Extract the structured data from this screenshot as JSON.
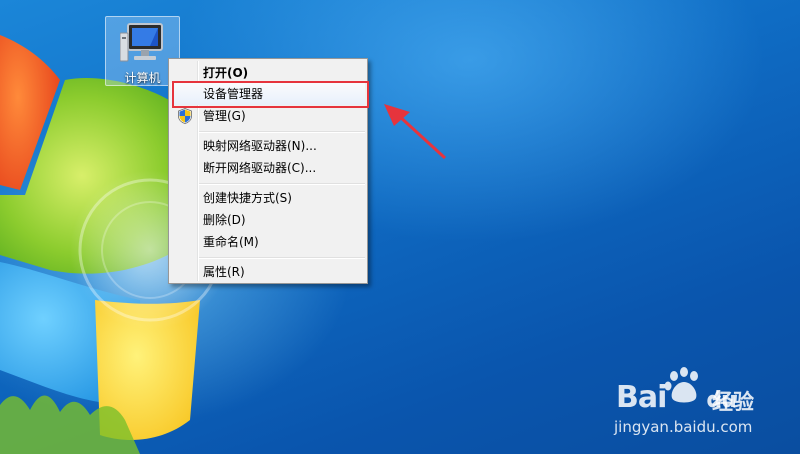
{
  "desktop": {
    "icon": {
      "label": "计算机",
      "icon_name": "computer-icon"
    }
  },
  "context_menu": {
    "items": [
      {
        "label": "打开(O)",
        "bold": true
      },
      {
        "label": "设备管理器",
        "highlighted": true
      },
      {
        "label": "管理(G)",
        "icon": "uac-shield-icon"
      },
      {
        "label": "映射网络驱动器(N)..."
      },
      {
        "label": "断开网络驱动器(C)..."
      },
      {
        "label": "创建快捷方式(S)"
      },
      {
        "label": "删除(D)"
      },
      {
        "label": "重命名(M)"
      },
      {
        "label": "属性(R)"
      }
    ]
  },
  "annotation": {
    "box_color": "#e6343d",
    "arrow_color": "#e6343d"
  },
  "watermark": {
    "brand": "Bai",
    "brand_du": "du",
    "cn": "经验",
    "url": "jingyan.baidu.com"
  }
}
